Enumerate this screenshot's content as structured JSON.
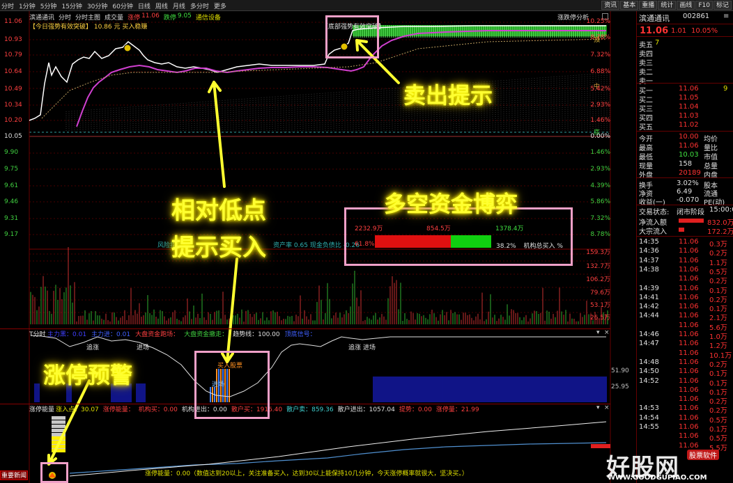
{
  "toolbar": {
    "periods": [
      "分时",
      "1分钟",
      "5分钟",
      "15分钟",
      "30分钟",
      "60分钟",
      "日线",
      "周线",
      "月线",
      "多分时",
      "更多"
    ],
    "buttons": [
      "资讯",
      "基本",
      "重播",
      "统计",
      "画线",
      "F10",
      "标记"
    ]
  },
  "infobar": {
    "stock": "滨通通讯",
    "items": [
      "分时",
      "分时主图",
      "成交量"
    ],
    "rise_label": "涨停",
    "rise_price": "11.06",
    "fall_label": "跌停",
    "fall_price": "9.05",
    "tag": "通信设备",
    "right_tag": "涨跌停分析"
  },
  "signal_today": "【今日强势有效突破】 10.86 元 买入稳赚",
  "signal_bottom": "【底部强势有效突破】",
  "price_axis_left": [
    "11.06",
    "10.93",
    "10.79",
    "10.64",
    "10.49",
    "10.34",
    "10.20",
    "10.05",
    "9.90",
    "9.75",
    "9.61",
    "9.46",
    "9.31",
    "9.17"
  ],
  "price_axis_right": [
    "10.25%",
    "8.78%",
    "7.32%",
    "6.88%",
    "5.42%",
    "2.93%",
    "1.46%",
    "0.00%",
    "1.46%",
    "2.93%",
    "4.39%",
    "5.86%",
    "7.32%",
    "8.78%"
  ],
  "vol_axis": [
    "159.3万",
    "132.7万",
    "106.2万",
    "79.6万",
    "53.1万",
    "26.5万"
  ],
  "labels": {
    "ding": "顶",
    "zhong": "中",
    "di": "底"
  },
  "fund_box": {
    "v1": "2232.9万",
    "v2": "854.5万",
    "v3": "1378.4万",
    "pct_left": "61.8%",
    "pct_right": "38.2%",
    "caption": "机构总买入 %",
    "risk": "风险指数",
    "zichan": "资产率",
    "zichan_val": "0.65",
    "net_flow": "现金负债比",
    "net_flow_val": "-0.26"
  },
  "mid_panel": {
    "title": "T分时",
    "legend": [
      "主力黑：0.01",
      "主力进：0.01",
      "大盘资金跑场：",
      "大盘资金撤走：",
      "趋势线：100.00",
      "顶底信号："
    ],
    "buy_label": "买入股票",
    "short_a": "追涨",
    "short_b": "进场",
    "short_c": "追涨",
    "short_d": "进场",
    "entry_a": "进场",
    "entry_b": "进场",
    "axis": [
      "51.90",
      "25.95"
    ]
  },
  "bottom_panel": {
    "title": "涨停能量",
    "legend": [
      "涨入点：30.07",
      "涨停能量：",
      "机构买：0.00",
      "机构进出：0.00",
      "散户买：1916.40",
      "散户卖：859.36",
      "散户进出：1057.04",
      "提势：0.00",
      "涨停量：21.99"
    ],
    "desc": "涨停能量：0.00（数值达到20以上，关注准备买入，达到30以上能保持10几分钟，今天涨停概率就很大，坚决买。）",
    "news_btn": "重要新闻"
  },
  "annotations": {
    "sell": "卖出提示",
    "buy_l1": "相对低点",
    "buy_l2": "提示买入",
    "fund": "多空资金博弈",
    "limit": "涨停预警"
  },
  "quote": {
    "name": "滨通通讯",
    "code": "002861",
    "price": "11.06",
    "change": "1.01",
    "pct": "10.05%",
    "asks": [
      {
        "label": "卖五",
        "mark": "7",
        "price": "",
        "vol": ""
      },
      {
        "label": "卖四",
        "mark": "",
        "price": "",
        "vol": ""
      },
      {
        "label": "卖三",
        "mark": "",
        "price": "",
        "vol": ""
      },
      {
        "label": "卖二",
        "mark": "",
        "price": "",
        "vol": ""
      },
      {
        "label": "卖一",
        "mark": "",
        "price": "",
        "vol": ""
      }
    ],
    "bids": [
      {
        "label": "买一",
        "price": "11.06",
        "vol": "",
        "mark": "9"
      },
      {
        "label": "买二",
        "price": "11.05",
        "vol": "",
        "mark": ""
      },
      {
        "label": "买三",
        "price": "11.04",
        "vol": "",
        "mark": ""
      },
      {
        "label": "买四",
        "price": "11.03",
        "vol": "",
        "mark": ""
      },
      {
        "label": "买五",
        "price": "11.02",
        "vol": "",
        "mark": ""
      }
    ],
    "stats": [
      {
        "l1": "今开",
        "v1": "10.00",
        "l2": "均价"
      },
      {
        "l1": "最高",
        "v1": "11.06",
        "l2": "量比"
      },
      {
        "l1": "最低",
        "v1": "10.03",
        "l2": "市值"
      },
      {
        "l1": "现量",
        "v1": "158",
        "l2": "总量"
      },
      {
        "l1": "外盘",
        "v1": "20189",
        "l2": "内盘"
      }
    ],
    "stats2": [
      {
        "l1": "换手",
        "v1": "3.02%",
        "l2": "股本"
      },
      {
        "l1": "净资",
        "v1": "6.49",
        "l2": "流通"
      },
      {
        "l1": "收益(一)",
        "v1": "-0.070",
        "l2": "PE(动)"
      }
    ],
    "status_label": "交易状态:",
    "status_value": "闭市阶段",
    "status_time": "15:00:0",
    "flow_in_label": "净流入额",
    "flow_in_value": "832.0万",
    "big_label": "大宗流入",
    "big_value": "172.2万"
  },
  "ticks": [
    {
      "t": "14:35",
      "p": "11.06",
      "v": "0.3万"
    },
    {
      "t": "14:36",
      "p": "11.06",
      "v": "0.2万"
    },
    {
      "t": "14:37",
      "p": "11.06",
      "v": "1.1万"
    },
    {
      "t": "14:38",
      "p": "11.06",
      "v": "0.5万"
    },
    {
      "t": "",
      "p": "11.06",
      "v": "0.2万"
    },
    {
      "t": "14:39",
      "p": "11.06",
      "v": "0.1万"
    },
    {
      "t": "14:41",
      "p": "11.06",
      "v": "0.2万"
    },
    {
      "t": "14:42",
      "p": "11.06",
      "v": "0.1万"
    },
    {
      "t": "14:44",
      "p": "11.06",
      "v": "2.1万"
    },
    {
      "t": "",
      "p": "11.06",
      "v": "5.6万"
    },
    {
      "t": "14:46",
      "p": "11.06",
      "v": "1.0万"
    },
    {
      "t": "14:47",
      "p": "11.06",
      "v": "1.2万"
    },
    {
      "t": "",
      "p": "11.06",
      "v": "10.1万"
    },
    {
      "t": "14:48",
      "p": "11.06",
      "v": "0.2万"
    },
    {
      "t": "14:50",
      "p": "11.06",
      "v": "0.1万"
    },
    {
      "t": "14:52",
      "p": "11.06",
      "v": "0.1万"
    },
    {
      "t": "",
      "p": "11.06",
      "v": "0.1万"
    },
    {
      "t": "",
      "p": "11.06",
      "v": "0.2万"
    },
    {
      "t": "14:53",
      "p": "11.06",
      "v": "0.2万"
    },
    {
      "t": "14:54",
      "p": "11.06",
      "v": "0.5万"
    },
    {
      "t": "14:55",
      "p": "11.06",
      "v": "0.1万"
    },
    {
      "t": "",
      "p": "11.06",
      "v": "0.5万"
    },
    {
      "t": "",
      "p": "11.06",
      "v": "5.5万"
    }
  ],
  "watermark": {
    "cn": "好股网",
    "en": "WWW.GOODGUPIAO.COM",
    "badge": "股票软件"
  },
  "colors": {
    "up": "#ff3232",
    "down": "#00e000",
    "gold": "#ffff30",
    "pink": "#f0a0c8"
  }
}
